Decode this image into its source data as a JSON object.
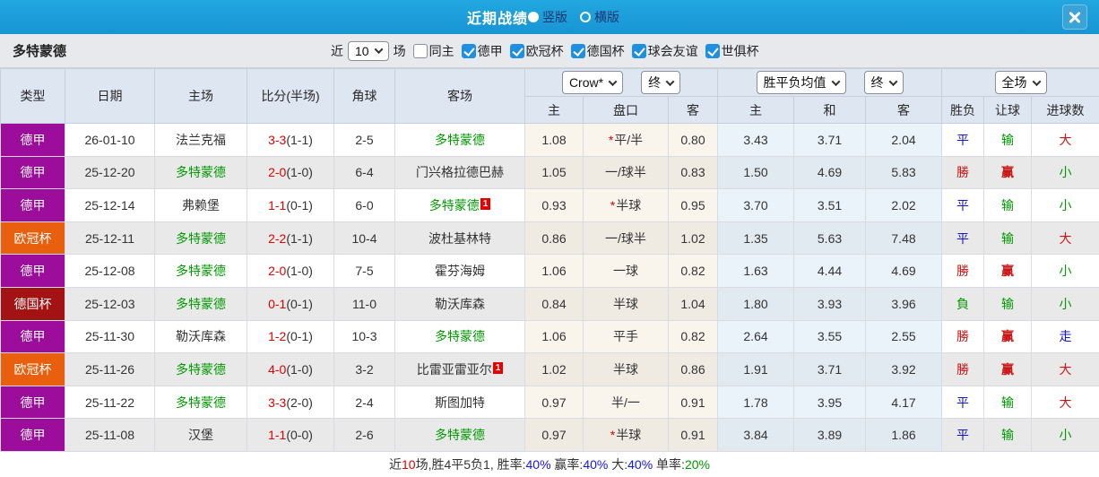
{
  "titlebar": {
    "title": "近期战绩",
    "radios": [
      {
        "label": "竖版",
        "selected": true
      },
      {
        "label": "横版",
        "selected": false
      }
    ]
  },
  "filterbar": {
    "team": "多特蒙德",
    "near_label": "近",
    "count_value": "10",
    "suffix_label": "场",
    "checkboxes": [
      {
        "label": "同主",
        "checked": false
      },
      {
        "label": "德甲",
        "checked": true
      },
      {
        "label": "欧冠杯",
        "checked": true
      },
      {
        "label": "德国杯",
        "checked": true
      },
      {
        "label": "球会友谊",
        "checked": true
      },
      {
        "label": "世俱杯",
        "checked": true
      }
    ]
  },
  "table": {
    "columns": [
      "类型",
      "日期",
      "主场",
      "比分(半场)",
      "角球",
      "客场"
    ],
    "sub_columns": [
      "主",
      "盘口",
      "客",
      "主",
      "和",
      "客",
      "胜负",
      "让球",
      "进球数"
    ],
    "dropdowns": {
      "crow": "Crow*",
      "crow_final": "终",
      "avg": "胜平负均值",
      "avg_final": "终",
      "scope": "全场"
    },
    "type_colors": {
      "德甲": "#9c0d9c",
      "欧冠杯": "#e8600d",
      "德国杯": "#a31313"
    },
    "result_colors": {
      "blue": "#1414cc",
      "red": "#cc1414",
      "green": "#009900"
    },
    "rows": [
      {
        "type": "德甲",
        "date": "26-01-10",
        "home": {
          "name": "法兰克福",
          "highlight": false,
          "badge": ""
        },
        "score": "3-3",
        "half": "(1-1)",
        "corners": "2-5",
        "away": {
          "name": "多特蒙德",
          "highlight": true,
          "badge": ""
        },
        "crow_home": "1.08",
        "star": true,
        "handicap": "平/半",
        "crow_away": "0.80",
        "avg_home": "3.43",
        "avg_draw": "3.71",
        "avg_away": "2.04",
        "wdl": {
          "t": "平",
          "c": "blue"
        },
        "let": {
          "t": "输",
          "c": "green"
        },
        "goal": {
          "t": "大",
          "c": "red"
        }
      },
      {
        "type": "德甲",
        "date": "25-12-20",
        "home": {
          "name": "多特蒙德",
          "highlight": true,
          "badge": ""
        },
        "score": "2-0",
        "half": "(1-0)",
        "corners": "6-4",
        "away": {
          "name": "门兴格拉德巴赫",
          "highlight": false,
          "badge": ""
        },
        "crow_home": "1.05",
        "star": false,
        "handicap": "一/球半",
        "crow_away": "0.83",
        "avg_home": "1.50",
        "avg_draw": "4.69",
        "avg_away": "5.83",
        "wdl": {
          "t": "勝",
          "c": "red"
        },
        "let": {
          "t": "赢",
          "c": "red"
        },
        "goal": {
          "t": "小",
          "c": "green"
        }
      },
      {
        "type": "德甲",
        "date": "25-12-14",
        "home": {
          "name": "弗赖堡",
          "highlight": false,
          "badge": ""
        },
        "score": "1-1",
        "half": "(0-1)",
        "corners": "6-0",
        "away": {
          "name": "多特蒙德",
          "highlight": true,
          "badge": "1"
        },
        "crow_home": "0.93",
        "star": true,
        "handicap": "半球",
        "crow_away": "0.95",
        "avg_home": "3.70",
        "avg_draw": "3.51",
        "avg_away": "2.02",
        "wdl": {
          "t": "平",
          "c": "blue"
        },
        "let": {
          "t": "输",
          "c": "green"
        },
        "goal": {
          "t": "小",
          "c": "green"
        }
      },
      {
        "type": "欧冠杯",
        "date": "25-12-11",
        "home": {
          "name": "多特蒙德",
          "highlight": true,
          "badge": ""
        },
        "score": "2-2",
        "half": "(1-1)",
        "corners": "10-4",
        "away": {
          "name": "波杜基林特",
          "highlight": false,
          "badge": ""
        },
        "crow_home": "0.86",
        "star": false,
        "handicap": "一/球半",
        "crow_away": "1.02",
        "avg_home": "1.35",
        "avg_draw": "5.63",
        "avg_away": "7.48",
        "wdl": {
          "t": "平",
          "c": "blue"
        },
        "let": {
          "t": "输",
          "c": "green"
        },
        "goal": {
          "t": "大",
          "c": "red"
        }
      },
      {
        "type": "德甲",
        "date": "25-12-08",
        "home": {
          "name": "多特蒙德",
          "highlight": true,
          "badge": ""
        },
        "score": "2-0",
        "half": "(1-0)",
        "corners": "7-5",
        "away": {
          "name": "霍芬海姆",
          "highlight": false,
          "badge": ""
        },
        "crow_home": "1.06",
        "star": false,
        "handicap": "一球",
        "crow_away": "0.82",
        "avg_home": "1.63",
        "avg_draw": "4.44",
        "avg_away": "4.69",
        "wdl": {
          "t": "勝",
          "c": "red"
        },
        "let": {
          "t": "赢",
          "c": "red"
        },
        "goal": {
          "t": "小",
          "c": "green"
        }
      },
      {
        "type": "德国杯",
        "date": "25-12-03",
        "home": {
          "name": "多特蒙德",
          "highlight": true,
          "badge": ""
        },
        "score": "0-1",
        "half": "(0-1)",
        "corners": "11-0",
        "away": {
          "name": "勒沃库森",
          "highlight": false,
          "badge": ""
        },
        "crow_home": "0.84",
        "star": false,
        "handicap": "半球",
        "crow_away": "1.04",
        "avg_home": "1.80",
        "avg_draw": "3.93",
        "avg_away": "3.96",
        "wdl": {
          "t": "負",
          "c": "green"
        },
        "let": {
          "t": "输",
          "c": "green"
        },
        "goal": {
          "t": "小",
          "c": "green"
        }
      },
      {
        "type": "德甲",
        "date": "25-11-30",
        "home": {
          "name": "勒沃库森",
          "highlight": false,
          "badge": ""
        },
        "score": "1-2",
        "half": "(0-1)",
        "corners": "10-3",
        "away": {
          "name": "多特蒙德",
          "highlight": true,
          "badge": ""
        },
        "crow_home": "1.06",
        "star": false,
        "handicap": "平手",
        "crow_away": "0.82",
        "avg_home": "2.64",
        "avg_draw": "3.55",
        "avg_away": "2.55",
        "wdl": {
          "t": "勝",
          "c": "red"
        },
        "let": {
          "t": "赢",
          "c": "red"
        },
        "goal": {
          "t": "走",
          "c": "blue"
        }
      },
      {
        "type": "欧冠杯",
        "date": "25-11-26",
        "home": {
          "name": "多特蒙德",
          "highlight": true,
          "badge": ""
        },
        "score": "4-0",
        "half": "(1-0)",
        "corners": "3-2",
        "away": {
          "name": "比雷亚雷亚尔",
          "highlight": false,
          "badge": "1"
        },
        "crow_home": "1.02",
        "star": false,
        "handicap": "半球",
        "crow_away": "0.86",
        "avg_home": "1.91",
        "avg_draw": "3.71",
        "avg_away": "3.92",
        "wdl": {
          "t": "勝",
          "c": "red"
        },
        "let": {
          "t": "赢",
          "c": "red"
        },
        "goal": {
          "t": "大",
          "c": "red"
        }
      },
      {
        "type": "德甲",
        "date": "25-11-22",
        "home": {
          "name": "多特蒙德",
          "highlight": true,
          "badge": ""
        },
        "score": "3-3",
        "half": "(2-0)",
        "corners": "2-4",
        "away": {
          "name": "斯图加特",
          "highlight": false,
          "badge": ""
        },
        "crow_home": "0.97",
        "star": false,
        "handicap": "半/一",
        "crow_away": "0.91",
        "avg_home": "1.78",
        "avg_draw": "3.95",
        "avg_away": "4.17",
        "wdl": {
          "t": "平",
          "c": "blue"
        },
        "let": {
          "t": "输",
          "c": "green"
        },
        "goal": {
          "t": "大",
          "c": "red"
        }
      },
      {
        "type": "德甲",
        "date": "25-11-08",
        "home": {
          "name": "汉堡",
          "highlight": false,
          "badge": ""
        },
        "score": "1-1",
        "half": "(0-0)",
        "corners": "2-6",
        "away": {
          "name": "多特蒙德",
          "highlight": true,
          "badge": ""
        },
        "crow_home": "0.97",
        "star": true,
        "handicap": "半球",
        "crow_away": "0.91",
        "avg_home": "3.84",
        "avg_draw": "3.89",
        "avg_away": "1.86",
        "wdl": {
          "t": "平",
          "c": "blue"
        },
        "let": {
          "t": "输",
          "c": "green"
        },
        "goal": {
          "t": "小",
          "c": "green"
        }
      }
    ]
  },
  "summary": {
    "segments": [
      {
        "text": "近",
        "color": "#333333"
      },
      {
        "text": "10",
        "color": "#e00000"
      },
      {
        "text": "场,胜4平5负1, 胜率:",
        "color": "#333333"
      },
      {
        "text": "40%",
        "color": "#1414ee"
      },
      {
        "text": " 赢率:",
        "color": "#333333"
      },
      {
        "text": "40%",
        "color": "#1414ee"
      },
      {
        "text": " 大:",
        "color": "#333333"
      },
      {
        "text": "40%",
        "color": "#1414ee"
      },
      {
        "text": " 单率:",
        "color": "#333333"
      },
      {
        "text": "20%",
        "color": "#009900"
      }
    ]
  }
}
